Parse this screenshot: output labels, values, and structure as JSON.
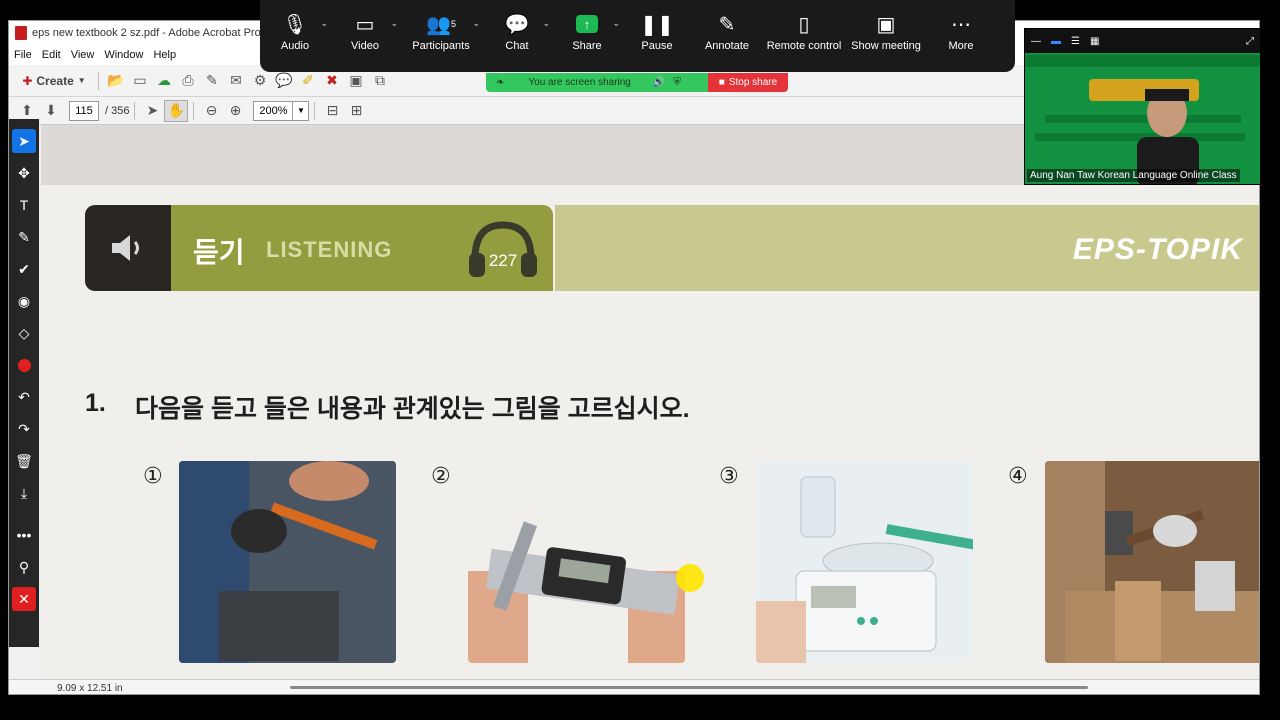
{
  "window": {
    "title": "eps new textbook 2 sz.pdf - Adobe Acrobat Pro"
  },
  "menubar": {
    "items": [
      "File",
      "Edit",
      "View",
      "Window",
      "Help"
    ]
  },
  "toolbar": {
    "create_label": "Create"
  },
  "nav": {
    "page_current": "115",
    "page_total": "/ 356",
    "zoom": "200%"
  },
  "zoom_meeting": {
    "controls": [
      {
        "label": "Audio",
        "icon": "microphone-icon"
      },
      {
        "label": "Video",
        "icon": "video-camera-icon"
      },
      {
        "label": "Participants",
        "icon": "participants-icon",
        "count": "5"
      },
      {
        "label": "Chat",
        "icon": "chat-icon"
      },
      {
        "label": "Share",
        "icon": "share-screen-icon"
      },
      {
        "label": "Pause",
        "icon": "pause-icon"
      },
      {
        "label": "Annotate",
        "icon": "pencil-icon"
      },
      {
        "label": "Remote control",
        "icon": "mouse-icon"
      },
      {
        "label": "Show meeting",
        "icon": "show-meeting-icon"
      },
      {
        "label": "More",
        "icon": "more-icon"
      }
    ],
    "sharing_banner": "You are screen sharing",
    "stop_share": "Stop share",
    "video_name": "Aung Nan Taw Korean Language Online Class"
  },
  "page": {
    "banner_ko": "듣기",
    "banner_en": "LISTENING",
    "audio_number": "227",
    "brand": "EPS-TOPIK",
    "question_number": "1.",
    "question_text": "다음을 듣고 들은 내용과 관계있는 그림을 고르십시오.",
    "options": [
      "①",
      "②",
      "③",
      "④"
    ]
  },
  "status": {
    "page_size": "9.09 x 12.51 in"
  },
  "colors": {
    "olive": "#939c3e",
    "light_olive": "#c8c98f",
    "dark": "#2a2623",
    "zoom_green": "#34c760",
    "stop_red": "#e5333a"
  }
}
